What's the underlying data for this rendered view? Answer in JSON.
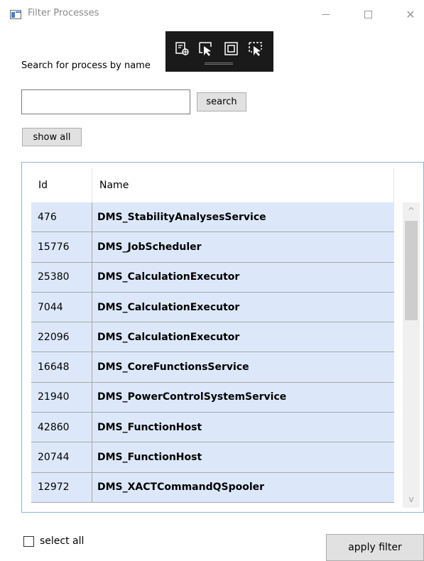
{
  "window": {
    "title": "Filter Processes",
    "min_icon": "minimize-icon",
    "max_icon": "maximize-icon",
    "close_icon": "close-icon",
    "close_glyph": "✕"
  },
  "devtools_bar": {
    "icons": [
      "live-visual-tree-icon",
      "select-element-icon",
      "display-layout-adorners-icon",
      "track-focused-element-icon"
    ]
  },
  "search": {
    "label": "Search for process by name",
    "input_value": "",
    "button_label": "search"
  },
  "show_all_label": "show all",
  "grid": {
    "columns": [
      "Id",
      "Name"
    ],
    "rows": [
      {
        "id": "476",
        "name": "DMS_StabilityAnalysesService"
      },
      {
        "id": "15776",
        "name": "DMS_JobScheduler"
      },
      {
        "id": "25380",
        "name": "DMS_CalculationExecutor"
      },
      {
        "id": "7044",
        "name": "DMS_CalculationExecutor"
      },
      {
        "id": "22096",
        "name": "DMS_CalculationExecutor"
      },
      {
        "id": "16648",
        "name": "DMS_CoreFunctionsService"
      },
      {
        "id": "21940",
        "name": "DMS_PowerControlSystemService"
      },
      {
        "id": "42860",
        "name": "DMS_FunctionHost"
      },
      {
        "id": "20744",
        "name": "DMS_FunctionHost"
      },
      {
        "id": "12972",
        "name": "DMS_XACTCommandQSpooler"
      }
    ],
    "row_background": "#dce8fa",
    "scroll_up_glyph": "^",
    "scroll_down_glyph": "v"
  },
  "select_all": {
    "label": "select all",
    "checked": false
  },
  "apply_filter_label": "apply filter"
}
